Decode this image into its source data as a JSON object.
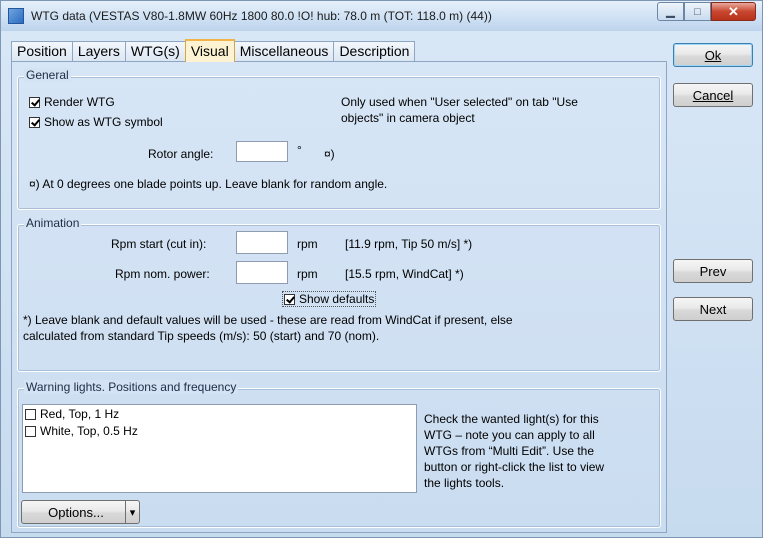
{
  "window": {
    "title": "WTG data   (VESTAS V80-1.8MW  60Hz 1800 80.0 !O! hub: 78.0 m (TOT: 118.0 m) (44))",
    "minimize_glyph": "▁",
    "maximize_glyph": "□",
    "close_glyph": "✕",
    "icon_text": "Wind PRO"
  },
  "tabs": [
    {
      "label": "Position"
    },
    {
      "label": "Layers"
    },
    {
      "label": "WTG(s)"
    },
    {
      "label": "Visual"
    },
    {
      "label": "Miscellaneous"
    },
    {
      "label": "Description"
    }
  ],
  "general": {
    "group_label": "General",
    "render_wtg_label": "Render WTG",
    "render_wtg_checked": true,
    "show_symbol_label": "Show as WTG symbol",
    "show_symbol_checked": true,
    "note_line1": "Only used when \"User selected\" on tab \"Use",
    "note_line2": "objects\" in camera object",
    "rotor_angle_label": "Rotor angle:",
    "rotor_angle_value": "",
    "rotor_angle_unit": "°",
    "rotor_angle_mark": "¤)",
    "footnote": "¤) At 0 degrees one blade points up. Leave blank for random angle."
  },
  "animation": {
    "group_label": "Animation",
    "rpm_start_label": "Rpm start (cut in):",
    "rpm_start_value": "",
    "rpm_start_unit": "rpm",
    "rpm_start_default": "[11.9 rpm, Tip 50 m/s] *)",
    "rpm_nom_label": "Rpm nom. power:",
    "rpm_nom_value": "",
    "rpm_nom_unit": "rpm",
    "rpm_nom_default": "[15.5 rpm, WindCat] *)",
    "show_defaults_label": "Show defaults",
    "show_defaults_checked": true,
    "note_line1": "*) Leave blank and default values will be used - these are read from WindCat if present, else",
    "note_line2": "calculated from standard Tip speeds (m/s): 50 (start) and 70 (nom)."
  },
  "warning_lights": {
    "group_label": "Warning lights. Positions and frequency",
    "items": [
      {
        "label": "Red, Top, 1 Hz",
        "checked": false
      },
      {
        "label": "White, Top, 0.5 Hz",
        "checked": false
      }
    ],
    "help_lines": [
      "Check the wanted light(s) for this",
      "WTG – note you can apply to all",
      "WTGs from “Multi Edit”. Use the",
      "button or right-click the list to view",
      "the lights tools."
    ],
    "options_label": "Options...",
    "dropdown_glyph": "▾"
  },
  "buttons": {
    "ok_label": "Ok",
    "cancel_label": "Cancel",
    "prev_label": "Prev",
    "next_label": "Next"
  }
}
